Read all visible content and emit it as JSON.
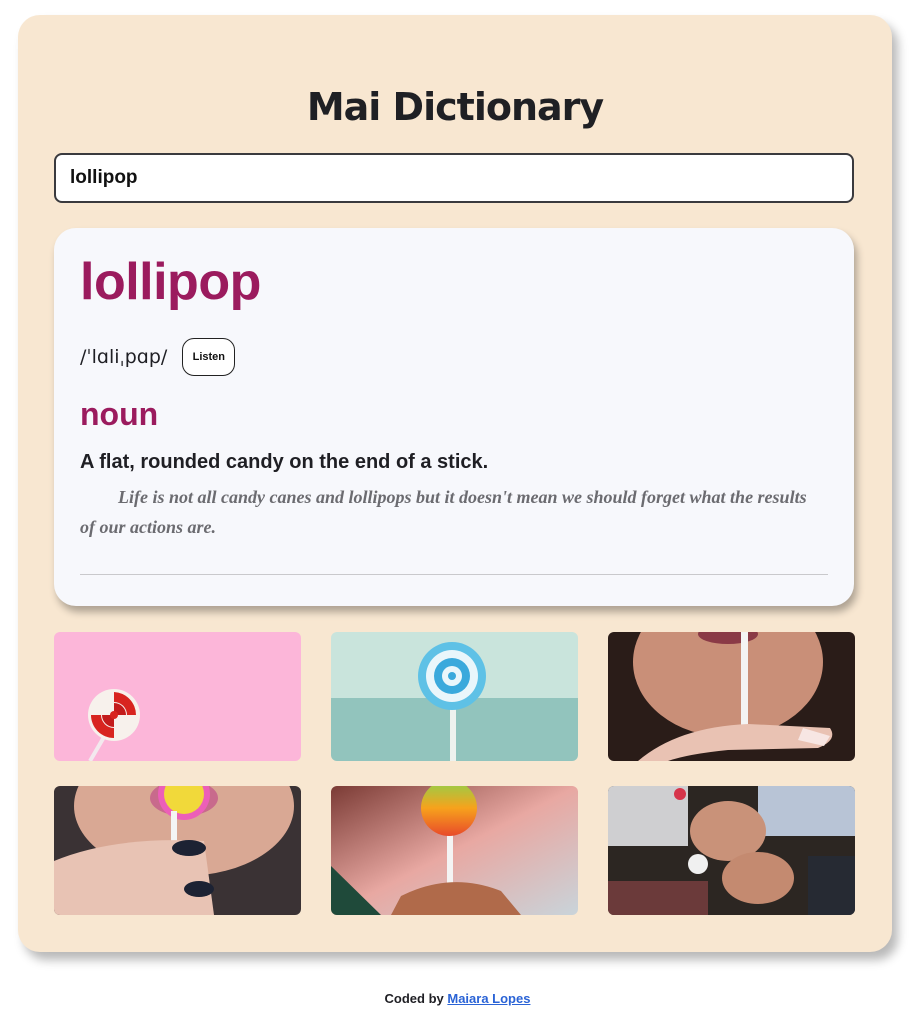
{
  "app": {
    "title": "Mai Dictionary"
  },
  "search": {
    "value": "lollipop"
  },
  "result": {
    "word": "lollipop",
    "phonetic": "/ˈlɑliˌpɑp/",
    "listen_label": "Listen",
    "meanings": [
      {
        "part_of_speech": "noun",
        "definition": "A flat, rounded candy on the end of a stick.",
        "example": "Life is not all candy canes and lollipops but it doesn't mean we should forget what the results of our actions are."
      }
    ]
  },
  "photos": [
    {
      "subject": "red-white-lollipop-pink-background"
    },
    {
      "subject": "blue-swirl-lollipop-teal-background"
    },
    {
      "subject": "woman-holding-lollipop-stick"
    },
    {
      "subject": "woman-licking-yellow-lollipop"
    },
    {
      "subject": "hand-holding-orange-lollipop"
    },
    {
      "subject": "two-women-with-lollipops"
    }
  ],
  "footer": {
    "prefix": "Coded by",
    "author_link": "Maiara Lopes"
  },
  "colors": {
    "app_background": "#f8e7d1",
    "card_background": "#f7f8fc",
    "accent": "#9b1b5e",
    "link": "#2a63d6"
  }
}
